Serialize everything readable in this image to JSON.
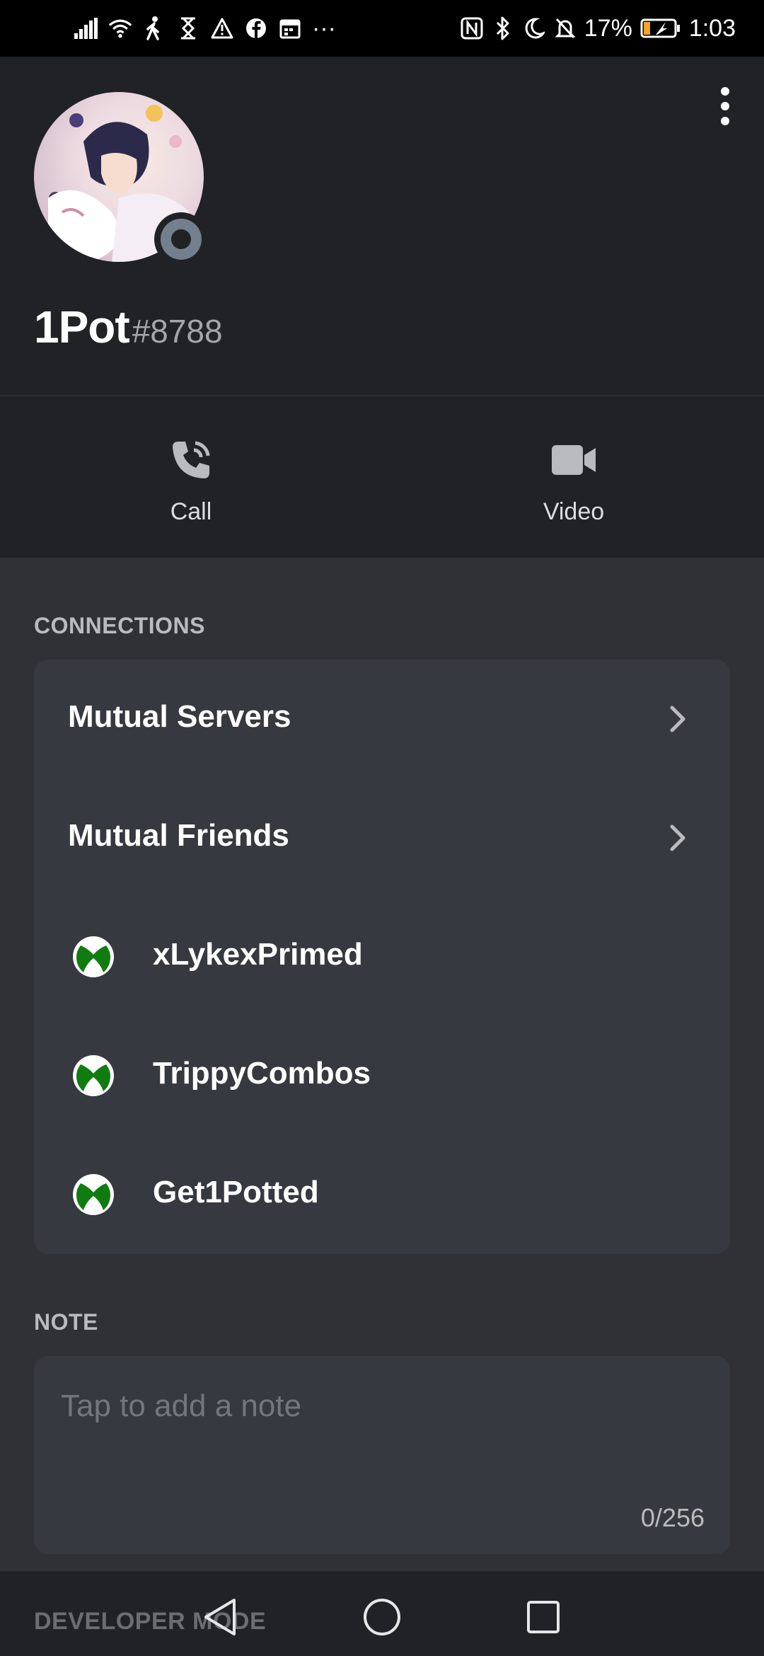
{
  "status_bar": {
    "battery": "17%",
    "time": "1:03",
    "overflow": "···"
  },
  "profile": {
    "username": "1Pot",
    "discriminator": "#8788",
    "status": "offline"
  },
  "actions": {
    "call_label": "Call",
    "video_label": "Video"
  },
  "connections": {
    "title": "CONNECTIONS",
    "mutual_servers": "Mutual Servers",
    "mutual_friends": "Mutual Friends",
    "accounts": [
      {
        "platform": "xbox",
        "name": "xLykexPrimed"
      },
      {
        "platform": "xbox",
        "name": "TrippyCombos"
      },
      {
        "platform": "xbox",
        "name": "Get1Potted"
      }
    ]
  },
  "note": {
    "title": "NOTE",
    "placeholder": "Tap to add a note",
    "value": "",
    "counter": "0/256"
  },
  "developer": {
    "title": "DEVELOPER MODE"
  },
  "colors": {
    "background": "#2f3136",
    "header": "#202225",
    "card": "#36393f",
    "xbox_green": "#107c10",
    "offline_gray": "#747f8d"
  }
}
